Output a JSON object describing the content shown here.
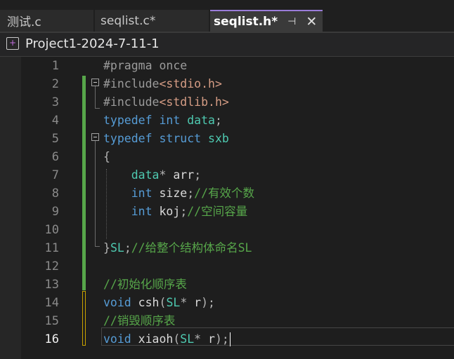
{
  "tabs": [
    {
      "label": "测试.c",
      "active": false
    },
    {
      "label": "seqlist.c*",
      "active": false
    },
    {
      "label": "seqlist.h*",
      "active": true,
      "pin_icon": "pin-icon",
      "close_icon": "close-icon"
    }
  ],
  "navbar": {
    "project_icon": "cpp-project-icon",
    "project_name": "Project1-2024-7-11-1"
  },
  "editor": {
    "current_line": 16,
    "lines": [
      {
        "n": "1",
        "segments": [
          [
            "pp",
            "#pragma once"
          ]
        ]
      },
      {
        "n": "2",
        "segments": [
          [
            "pp",
            "#include"
          ],
          [
            "st",
            "<stdio.h>"
          ]
        ]
      },
      {
        "n": "3",
        "segments": [
          [
            "pp",
            "#include"
          ],
          [
            "st",
            "<stdlib.h>"
          ]
        ]
      },
      {
        "n": "4",
        "segments": [
          [
            "kw",
            "typedef"
          ],
          [
            "vr",
            " "
          ],
          [
            "kw",
            "int"
          ],
          [
            "vr",
            " "
          ],
          [
            "ty",
            "data"
          ],
          [
            "pn",
            ";"
          ]
        ]
      },
      {
        "n": "5",
        "segments": [
          [
            "kw",
            "typedef"
          ],
          [
            "vr",
            " "
          ],
          [
            "kw",
            "struct"
          ],
          [
            "vr",
            " "
          ],
          [
            "ty",
            "sxb"
          ]
        ]
      },
      {
        "n": "6",
        "segments": [
          [
            "pn",
            "{"
          ]
        ]
      },
      {
        "n": "7",
        "segments": [
          [
            "vr",
            "    "
          ],
          [
            "ty",
            "data"
          ],
          [
            "pn",
            "*"
          ],
          [
            "vr",
            " arr"
          ],
          [
            "pn",
            ";"
          ]
        ]
      },
      {
        "n": "8",
        "segments": [
          [
            "vr",
            "    "
          ],
          [
            "kw",
            "int"
          ],
          [
            "vr",
            " size"
          ],
          [
            "pn",
            ";"
          ],
          [
            "cm",
            "//有效个数"
          ]
        ]
      },
      {
        "n": "9",
        "segments": [
          [
            "vr",
            "    "
          ],
          [
            "kw",
            "int"
          ],
          [
            "vr",
            " koj"
          ],
          [
            "pn",
            ";"
          ],
          [
            "cm",
            "//空间容量"
          ]
        ]
      },
      {
        "n": "10",
        "segments": [
          [
            "vr",
            ""
          ]
        ]
      },
      {
        "n": "11",
        "segments": [
          [
            "pn",
            "}"
          ],
          [
            "ty",
            "SL"
          ],
          [
            "pn",
            ";"
          ],
          [
            "cm",
            "//给整个结构体命名SL"
          ]
        ]
      },
      {
        "n": "12",
        "segments": [
          [
            "vr",
            ""
          ]
        ]
      },
      {
        "n": "13",
        "segments": [
          [
            "cm",
            "//初始化顺序表"
          ]
        ]
      },
      {
        "n": "14",
        "segments": [
          [
            "kw",
            "void"
          ],
          [
            "vr",
            " csh"
          ],
          [
            "pn",
            "("
          ],
          [
            "ty",
            "SL"
          ],
          [
            "pn",
            "*"
          ],
          [
            "vr",
            " r"
          ],
          [
            "pn",
            ");"
          ]
        ]
      },
      {
        "n": "15",
        "segments": [
          [
            "cm",
            "//销毁顺序表"
          ]
        ]
      },
      {
        "n": "16",
        "segments": [
          [
            "kw",
            "void"
          ],
          [
            "vr",
            " xiaoh"
          ],
          [
            "pn",
            "("
          ],
          [
            "ty",
            "SL"
          ],
          [
            "pn",
            "*"
          ],
          [
            "vr",
            " r"
          ],
          [
            "pn",
            ");"
          ]
        ]
      }
    ]
  },
  "colors": {
    "keyword": "#569cd6",
    "type": "#4ec9b0",
    "string": "#d69d85",
    "comment": "#57a64a",
    "change_saved": "#57a64a",
    "change_unsaved": "#c8a200",
    "active_tab_accent": "#9a7cd9"
  }
}
